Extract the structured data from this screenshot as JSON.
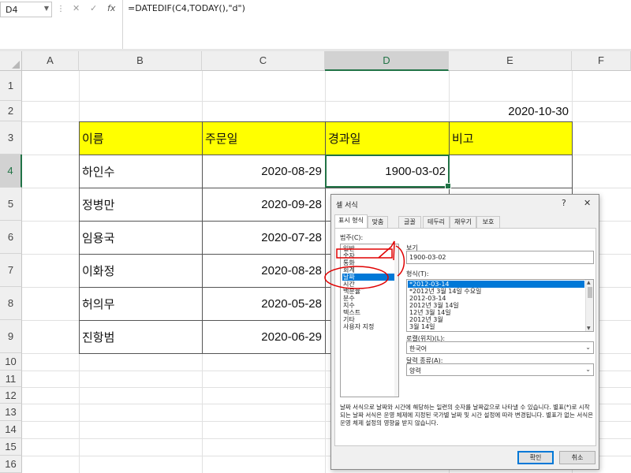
{
  "formula_bar": {
    "name_box": "D4",
    "formula": "=DATEDIF(C4,TODAY(),\"d\")",
    "icons": [
      "more-icon",
      "cancel-icon",
      "enter-icon",
      "function-icon"
    ]
  },
  "columns": [
    "A",
    "B",
    "C",
    "D",
    "E",
    "F"
  ],
  "rows": [
    "1",
    "2",
    "3",
    "4",
    "5",
    "6",
    "7",
    "8",
    "9",
    "10",
    "11",
    "12",
    "13",
    "14",
    "15",
    "16"
  ],
  "cells": {
    "E2": "2020-10-30",
    "headers": [
      "이름",
      "주문일",
      "경과일",
      "비고"
    ],
    "data": [
      {
        "name": "하인수",
        "date": "2020-08-29",
        "elapsed": "1900-03-02"
      },
      {
        "name": "정병만",
        "date": "2020-09-28"
      },
      {
        "name": "임용국",
        "date": "2020-07-28"
      },
      {
        "name": "이화정",
        "date": "2020-08-28"
      },
      {
        "name": "허의무",
        "date": "2020-05-28"
      },
      {
        "name": "진항범",
        "date": "2020-06-29"
      }
    ]
  },
  "dialog": {
    "title": "셀 서식",
    "help": "?",
    "close": "✕",
    "tabs": [
      "표시 형식",
      "맞춤",
      "글꼴",
      "테두리",
      "채우기",
      "보호"
    ],
    "category_label": "범주(C):",
    "categories": [
      "일반",
      "숫자",
      "통화",
      "회계",
      "날짜",
      "시간",
      "백분율",
      "분수",
      "지수",
      "텍스트",
      "기타",
      "사용자 지정"
    ],
    "selected_category": "날짜",
    "sample_label": "보기",
    "sample_value": "1900-03-02",
    "type_label": "형식(T):",
    "types": [
      "*2012-03-14",
      "*2012년 3월 14일 수요일",
      "2012-03-14",
      "2012년 3월 14일",
      "12년 3월 14일",
      "2012년 3월",
      "3월 14일"
    ],
    "selected_type": "*2012-03-14",
    "locale_label": "로캘(위치)(L):",
    "locale_value": "한국어",
    "calendar_label": "달력 종류(A):",
    "calendar_value": "양력",
    "description": "날짜 서식으로 날짜와 시간에 해당하는 일련의 숫자를 날짜값으로 나타낼 수 있습니다. 별표(*)로 시작되는 날짜 서식은 운영 체제에 지정된 국가별 날짜 및 시간 설정에 따라 변경됩니다. 별표가 없는 서식은 운영 체제 설정의 영향을 받지 않습니다.",
    "ok": "확인",
    "cancel": "취소"
  },
  "colors": {
    "header_fill": "#ffff00",
    "excel_green": "#217346",
    "selection_blue": "#0078d7",
    "annotation_red": "#e00000"
  }
}
